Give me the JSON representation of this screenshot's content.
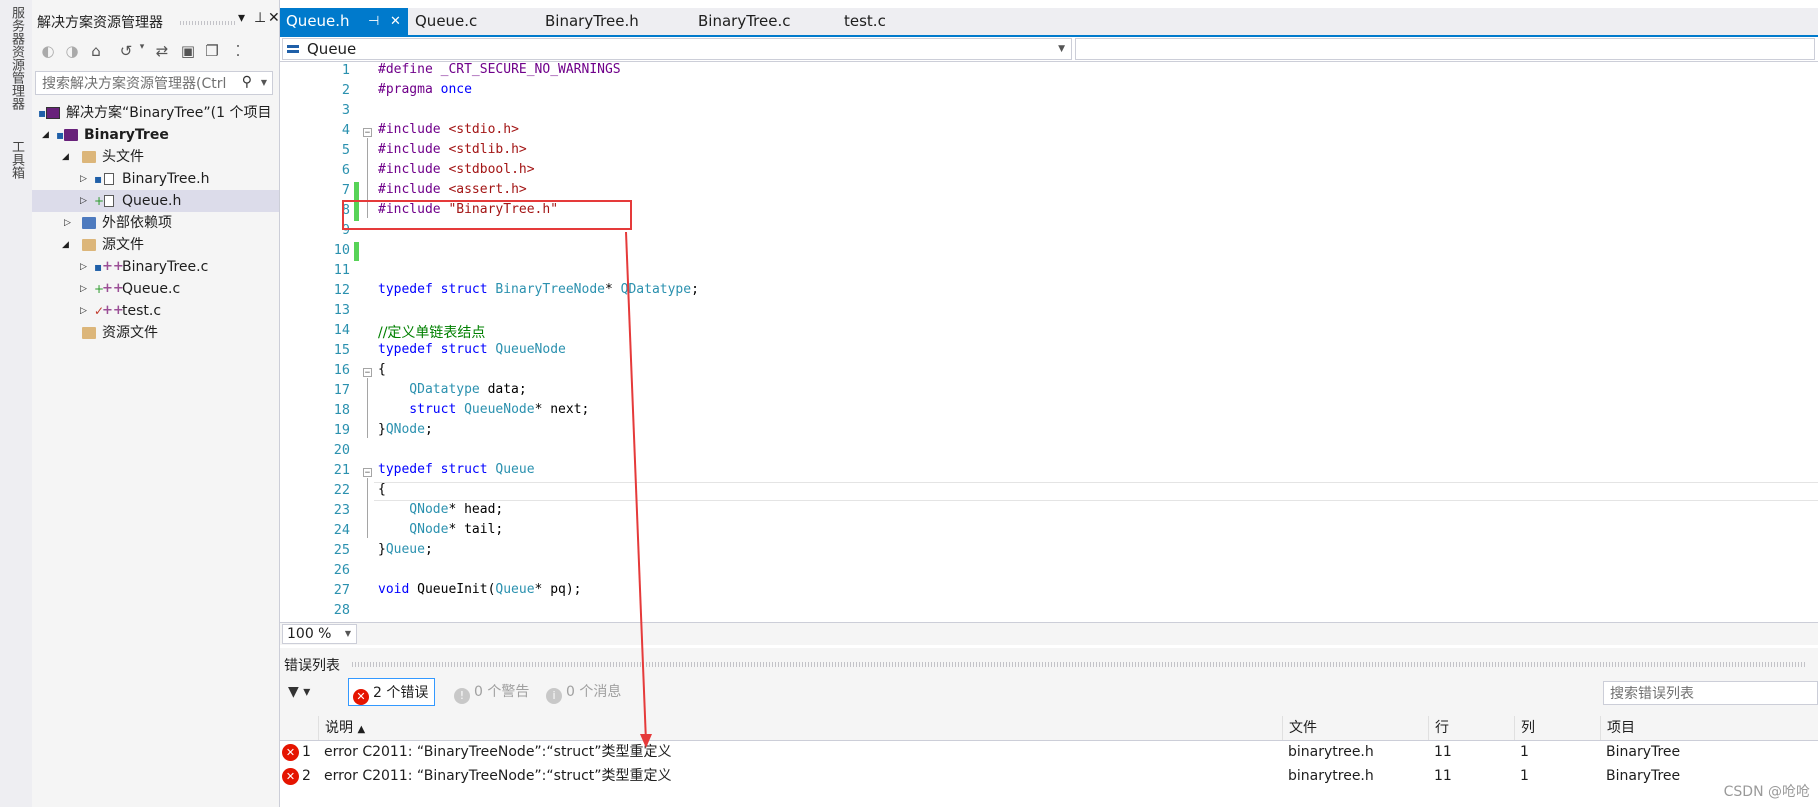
{
  "vertical_tabs": [
    "服务器资源管理器",
    "工具箱"
  ],
  "solution_explorer": {
    "title": "解决方案资源管理器",
    "search_placeholder": "搜索解决方案资源管理器(Ctrl",
    "tree": [
      {
        "label": "解决方案“BinaryTree”(1 个项目",
        "level": 0
      },
      {
        "label": "BinaryTree",
        "level": 1
      },
      {
        "label": "头文件",
        "level": 2
      },
      {
        "label": "BinaryTree.h",
        "level": 3
      },
      {
        "label": "Queue.h",
        "level": 3
      },
      {
        "label": "外部依赖项",
        "level": 2
      },
      {
        "label": "源文件",
        "level": 2
      },
      {
        "label": "BinaryTree.c",
        "level": 3
      },
      {
        "label": "Queue.c",
        "level": 3
      },
      {
        "label": "test.c",
        "level": 3
      },
      {
        "label": "资源文件",
        "level": 2
      }
    ]
  },
  "tabs": [
    {
      "label": "Queue.h",
      "active": true
    },
    {
      "label": "Queue.c",
      "active": false
    },
    {
      "label": "BinaryTree.h",
      "active": false
    },
    {
      "label": "BinaryTree.c",
      "active": false
    },
    {
      "label": "test.c",
      "active": false
    }
  ],
  "nav_scope": "Queue",
  "code_lines": [
    {
      "n": "1"
    },
    {
      "n": "2"
    },
    {
      "n": "3"
    },
    {
      "n": "4"
    },
    {
      "n": "5"
    },
    {
      "n": "6"
    },
    {
      "n": "7"
    },
    {
      "n": "8"
    },
    {
      "n": "9"
    },
    {
      "n": "10"
    },
    {
      "n": "11"
    },
    {
      "n": "12"
    },
    {
      "n": "13"
    },
    {
      "n": "14"
    },
    {
      "n": "15"
    },
    {
      "n": "16"
    },
    {
      "n": "17"
    },
    {
      "n": "18"
    },
    {
      "n": "19"
    },
    {
      "n": "20"
    },
    {
      "n": "21"
    },
    {
      "n": "22"
    },
    {
      "n": "23"
    },
    {
      "n": "24"
    },
    {
      "n": "25"
    },
    {
      "n": "26"
    },
    {
      "n": "27"
    },
    {
      "n": "28"
    }
  ],
  "code": {
    "l1a": "#define",
    "l1b": " _CRT_SECURE_NO_WARNINGS",
    "l2a": "#pragma",
    "l2b": " once",
    "l4a": "#include",
    "l4b": " <stdio.h>",
    "l5a": "#include",
    "l5b": " <stdlib.h>",
    "l6a": "#include",
    "l6b": " <stdbool.h>",
    "l7a": "#include",
    "l7b": " <assert.h>",
    "l8a": "#include",
    "l8b": " \"BinaryTree.h\"",
    "l12a": "typedef struct",
    "l12b": " BinaryTreeNode",
    "l12c": "* ",
    "l12d": "QDatatype",
    "l12e": ";",
    "l14": "//定义单链表结点",
    "l15a": "typedef struct",
    "l15b": " QueueNode",
    "l16": "{",
    "l17a": "    QDatatype",
    "l17b": " data;",
    "l18a": "    struct",
    "l18b": " QueueNode",
    "l18c": "* next;",
    "l19a": "}",
    "l19b": "QNode",
    "l19c": ";",
    "l21a": "typedef struct",
    "l21b": " Queue",
    "l22": "{",
    "l23a": "    QNode",
    "l23b": "* head;",
    "l24a": "    QNode",
    "l24b": "* tail;",
    "l25a": "}",
    "l25b": "Queue",
    "l25c": ";",
    "l27a": "void",
    "l27b": " QueueInit(",
    "l27c": "Queue",
    "l27d": "* pq);"
  },
  "zoom": "100 %",
  "error_list": {
    "title": "错误列表",
    "errors_btn": "2 个错误",
    "warnings_btn": "0 个警告",
    "messages_btn": "0 个消息",
    "search_placeholder": "搜索错误列表",
    "headers": {
      "desc": "说明",
      "file": "文件",
      "line": "行",
      "col": "列",
      "project": "项目"
    },
    "rows": [
      {
        "num": "1",
        "desc": "error C2011: “BinaryTreeNode”:“struct”类型重定义",
        "file": "binarytree.h",
        "line": "11",
        "col": "1",
        "project": "BinaryTree"
      },
      {
        "num": "2",
        "desc": "error C2011: “BinaryTreeNode”:“struct”类型重定义",
        "file": "binarytree.h",
        "line": "11",
        "col": "1",
        "project": "BinaryTree"
      }
    ]
  },
  "watermark": "CSDN @呛呛",
  "colors": {
    "accent": "#007acc",
    "error": "#e51400",
    "annotation": "#e53a3a",
    "changed_line": "#57d357"
  }
}
